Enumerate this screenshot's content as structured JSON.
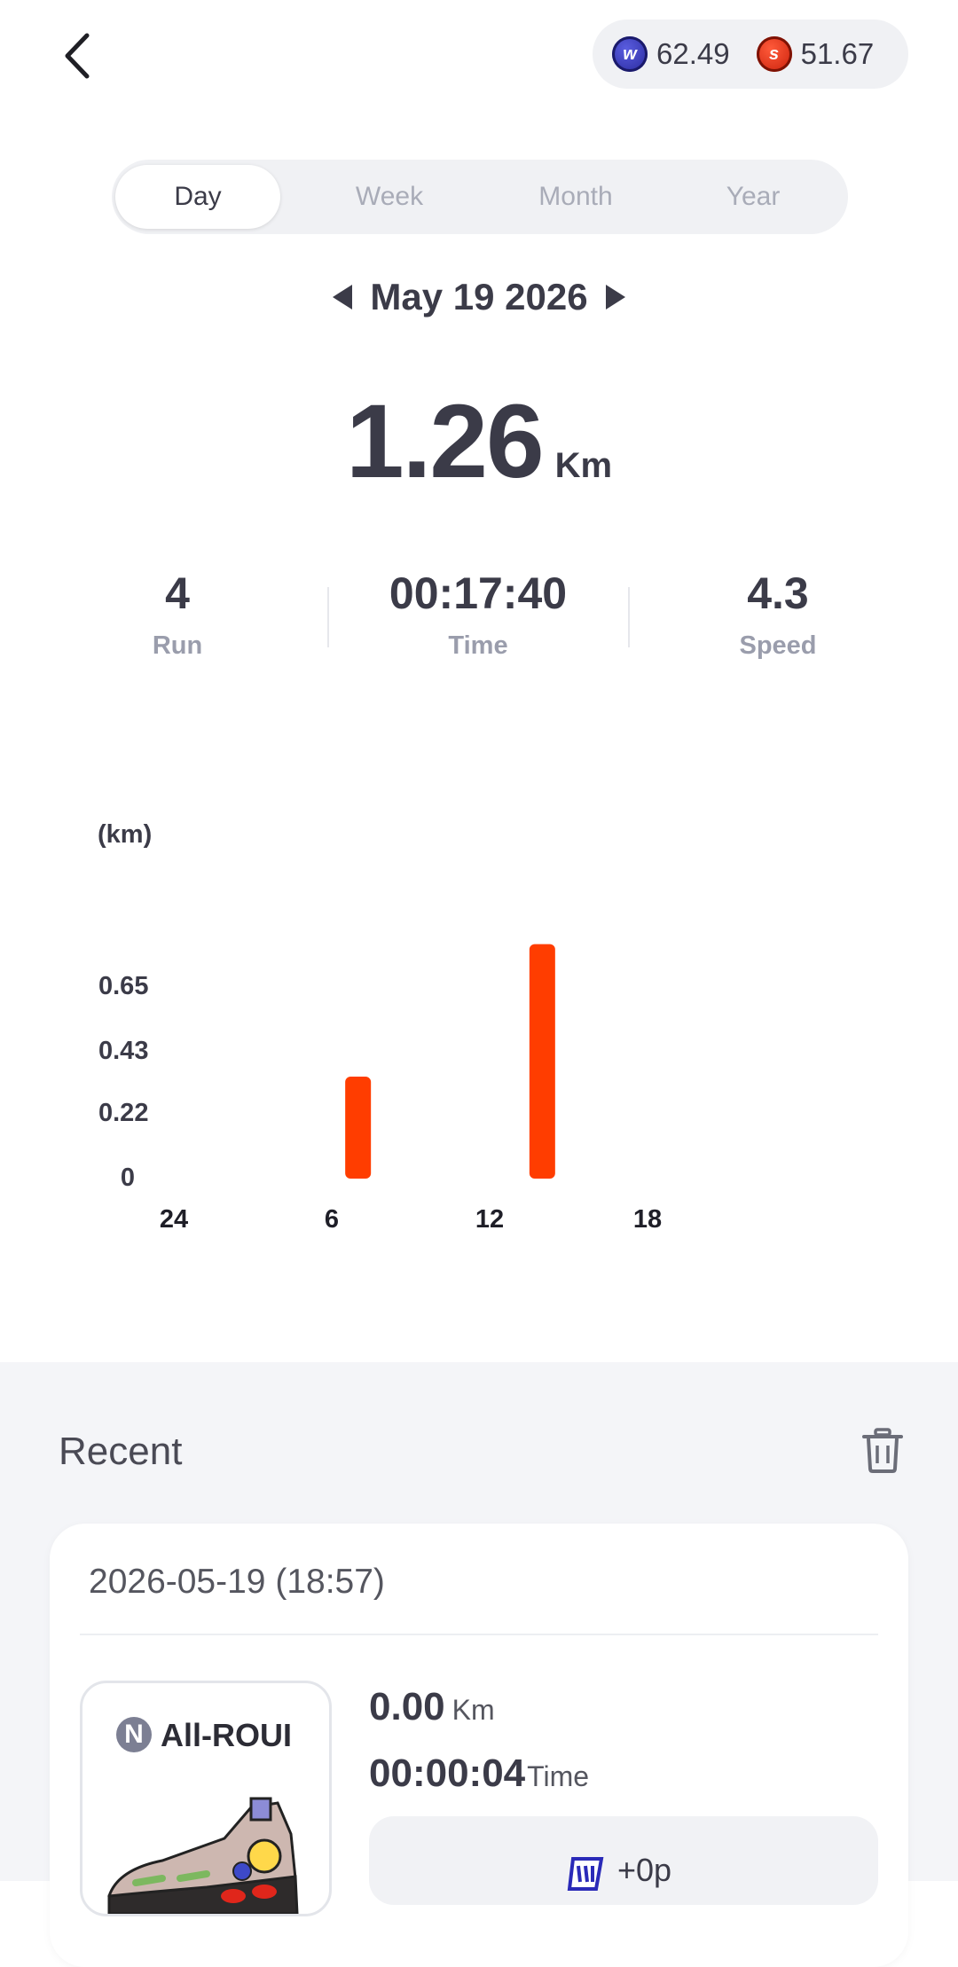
{
  "header": {
    "tokens": [
      {
        "icon": "w-coin-icon",
        "value": "62.49"
      },
      {
        "icon": "s-coin-icon",
        "value": "51.67"
      }
    ]
  },
  "tabs": [
    {
      "label": "Day",
      "active": true
    },
    {
      "label": "Week",
      "active": false
    },
    {
      "label": "Month",
      "active": false
    },
    {
      "label": "Year",
      "active": false
    }
  ],
  "date": "May 19 2026",
  "summary": {
    "distance": "1.26",
    "distance_unit": "Km",
    "stats": [
      {
        "value": "4",
        "label": "Run"
      },
      {
        "value": "00:17:40",
        "label": "Time"
      },
      {
        "value": "4.3",
        "label": "Speed"
      }
    ]
  },
  "chart_data": {
    "type": "bar",
    "ylabel": "(km)",
    "yticks": [
      "0",
      "0.22",
      "0.43",
      "0.65"
    ],
    "xticks": [
      "24",
      "6",
      "12",
      "18"
    ],
    "ylim": [
      0,
      0.87
    ],
    "xlim": [
      0,
      24
    ],
    "x": [
      7,
      14
    ],
    "values": [
      0.34,
      0.79
    ],
    "color": "#ff3d00"
  },
  "recent": {
    "title": "Recent",
    "entry": {
      "datetime": "2026-05-19 (18:57)",
      "shoe_name": "All-ROUI",
      "shoe_badge": "N",
      "distance": "0.00",
      "distance_unit": "Km",
      "time": "00:00:04",
      "time_label": "Time",
      "reward": "+0p"
    }
  }
}
